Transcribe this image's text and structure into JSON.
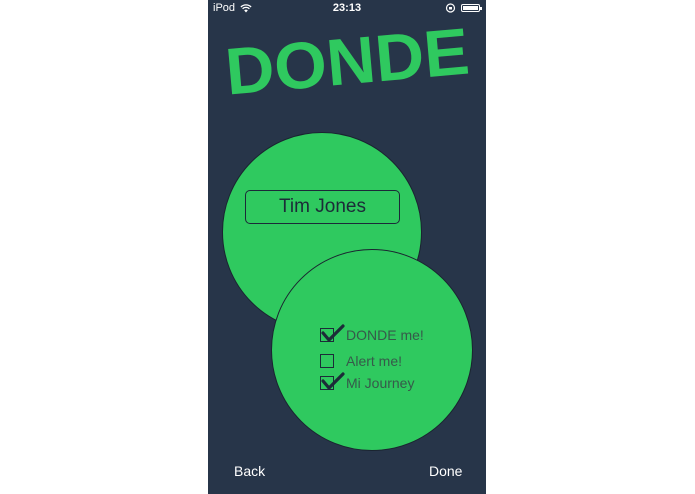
{
  "status_bar": {
    "carrier": "iPod",
    "time": "23:13",
    "icons": [
      "wifi-icon",
      "rotation-lock-icon",
      "battery-icon"
    ]
  },
  "logo": {
    "text": "DONDE",
    "color": "#2fc95f"
  },
  "profile": {
    "name": "Tim Jones"
  },
  "options": [
    {
      "label": "DONDE me!",
      "checked": true
    },
    {
      "label": "Alert me!",
      "checked": false
    },
    {
      "label": "Mi Journey",
      "checked": true
    }
  ],
  "nav": {
    "back_label": "Back",
    "done_label": "Done"
  },
  "colors": {
    "background": "#273549",
    "circle": "#2fc95f",
    "text_dark": "#1c2b38"
  }
}
